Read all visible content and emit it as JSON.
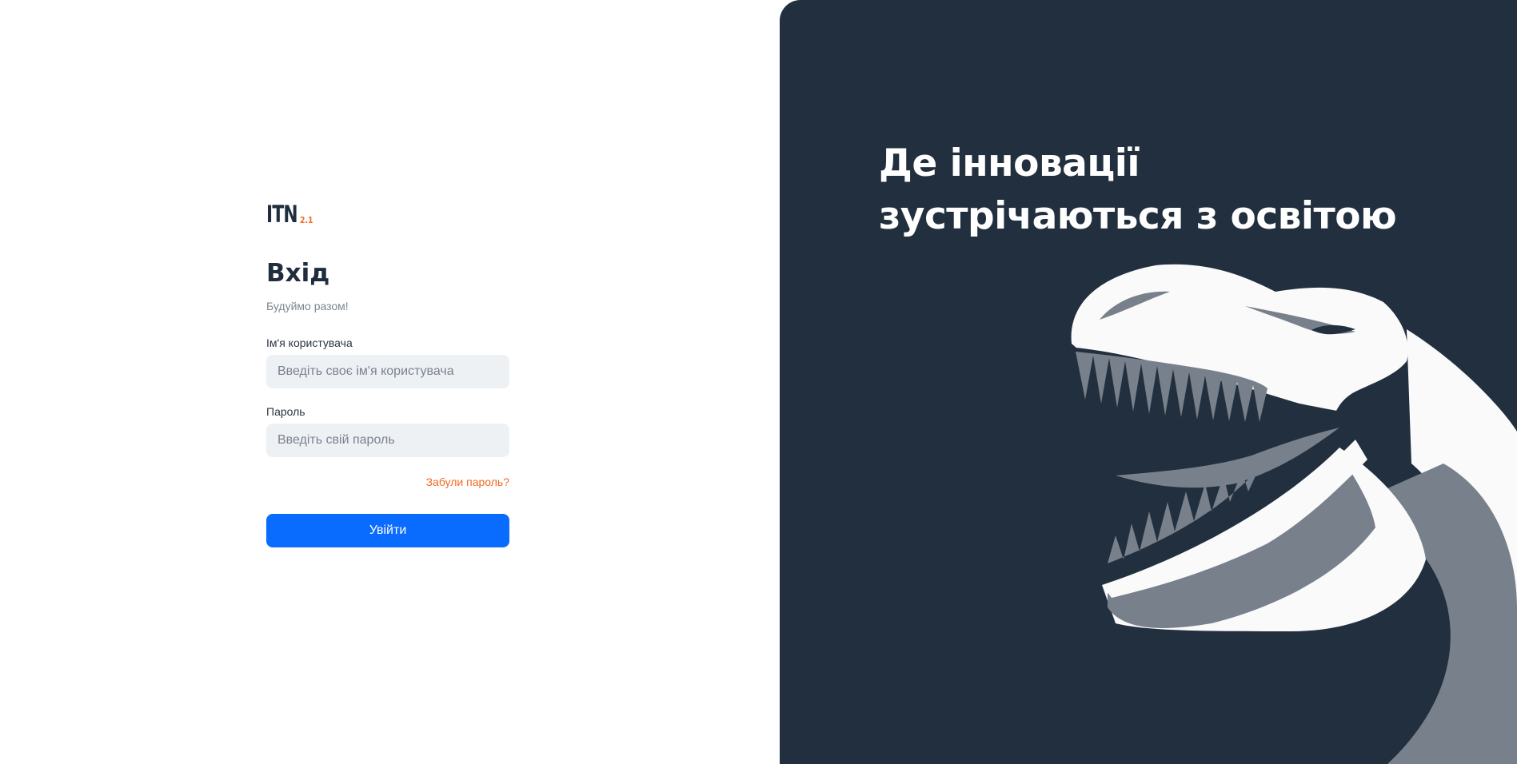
{
  "logo": {
    "main": "ITN",
    "version": "2.1"
  },
  "login": {
    "title": "Вхід",
    "subtitle": "Будуймо разом!",
    "username": {
      "label": "Ім'я користувача",
      "placeholder": "Введіть своє ім'я користувача",
      "value": ""
    },
    "password": {
      "label": "Пароль",
      "placeholder": "Введіть свій пароль",
      "value": ""
    },
    "forgot_label": "Забули пароль?",
    "submit_label": "Увійти"
  },
  "hero": {
    "title": "Де інновації зустрічаються з освітою"
  },
  "colors": {
    "accent": "#0a6cff",
    "brand_orange": "#f26b21",
    "panel_dark": "#212f3e",
    "input_bg": "#eef1f4"
  },
  "icons": {
    "hero_illustration": "dinosaur-head-icon"
  }
}
